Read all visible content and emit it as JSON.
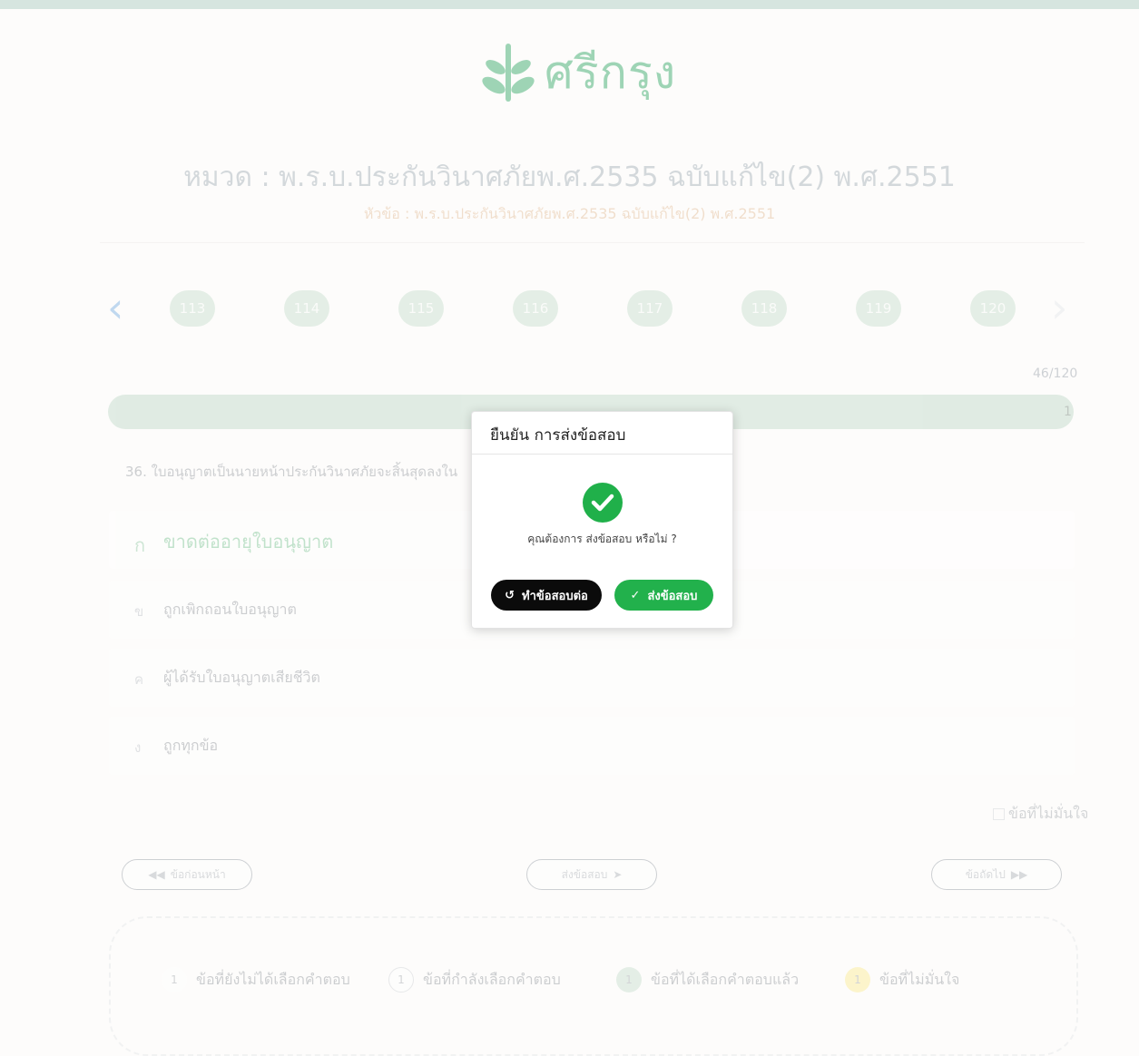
{
  "brand": {
    "name": "ศรีกรุง",
    "color": "#1c9f57",
    "icon": "wheat-leaf-icon"
  },
  "header": {
    "title": "หมวด : พ.ร.บ.ประกันวินาศภัยพ.ศ.2535 ฉบับแก้ไข(2) พ.ศ.2551",
    "subtitle": "หัวข้อ : พ.ร.บ.ประกันวินาศภัยพ.ศ.2535 ฉบับแก้ไข(2) พ.ศ.2551"
  },
  "pager": {
    "prev_icon": "chevron-left-icon",
    "next_icon": "chevron-right-icon",
    "numbers": [
      "113",
      "114",
      "115",
      "116",
      "117",
      "118",
      "119",
      "120"
    ]
  },
  "progress": {
    "count": "46/120",
    "end_label": "1",
    "fraction": 0.38
  },
  "question": {
    "text": "36. ใบอนุญาตเป็นนายหน้าประกันวินาศภัยจะสิ้นสุดลงใน",
    "choices": [
      {
        "letter": "ก",
        "text": "ขาดต่ออายุใบอนุญาต"
      },
      {
        "letter": "ข",
        "text": "ถูกเพิกถอนใบอนุญาต"
      },
      {
        "letter": "ค",
        "text": "ผู้ได้รับใบอนุญาตเสียชีวิต"
      },
      {
        "letter": "ง",
        "text": "ถูกทุกข้อ"
      }
    ]
  },
  "unsure_checkbox": {
    "label": "ข้อที่ไม่มั่นใจ",
    "checked": false
  },
  "footer_buttons": {
    "prev": "ข้อก่อนหน้า",
    "submit": "ส่งข้อสอบ",
    "next": "ข้อถัดไป"
  },
  "legend": [
    {
      "num": "1",
      "label": "ข้อที่ยังไม่ได้เลือกคำตอบ",
      "color": "#ffffff"
    },
    {
      "num": "1",
      "label": "ข้อที่กำลังเลือกคำตอบ",
      "color": "#ffffff"
    },
    {
      "num": "1",
      "label": "ข้อที่ได้เลือกคำตอบแล้ว",
      "color": "#c3ddca"
    },
    {
      "num": "1",
      "label": "ข้อที่ไม่มั่นใจ",
      "color": "#fbeb8a"
    }
  ],
  "modal": {
    "title": "ยืนยัน การส่งข้อสอบ",
    "icon": "check-circle-icon",
    "message": "คุณต้องการ ส่งข้อสอบ หรือไม่ ?",
    "continue_label": "ทำข้อสอบต่อ",
    "submit_label": "ส่งข้อสอบ"
  }
}
